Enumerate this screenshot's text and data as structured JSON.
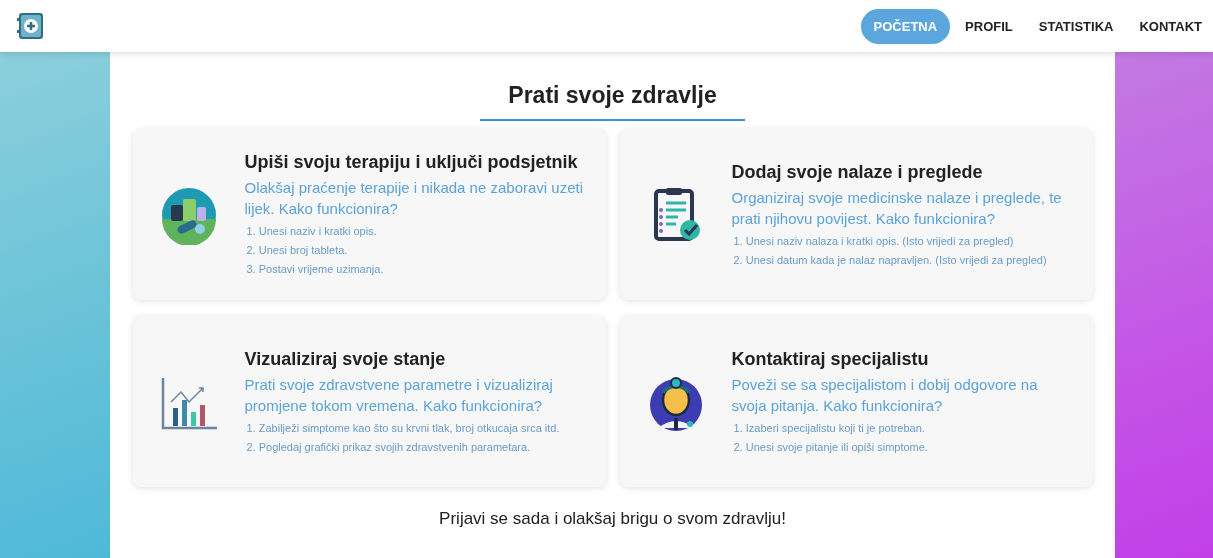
{
  "nav": {
    "items": [
      {
        "label": "POČETNA",
        "selected": true
      },
      {
        "label": "PROFIL",
        "selected": false
      },
      {
        "label": "STATISTIKA",
        "selected": false
      },
      {
        "label": "KONTAKT",
        "selected": false
      }
    ]
  },
  "main": {
    "title": "Prati svoje zdravlje",
    "cards": [
      {
        "kind": "pills",
        "title": "Upiši svoju terapiju i uključi podsjetnik",
        "description": "Olakšaj praćenje terapije i nikada ne zaboravi uzeti lijek. Kako funkcionira?",
        "steps": [
          "1. Unesi naziv i kratki opis.",
          "2. Unesi broj tableta.",
          "3. Postavi vrijeme uzimanja."
        ]
      },
      {
        "kind": "clipboard",
        "title": "Dodaj svoje nalaze i preglede",
        "description": "Organiziraj svoje medicinske nalaze i preglede, te prati njihovu povijest. Kako funkcionira?",
        "steps": [
          "1. Unesi naziv nalaza i kratki opis. (Isto vrijedi za pregled)",
          "2. Unesi datum kada je nalaz napravljen. (Isto vrijedi za pregled)"
        ]
      },
      {
        "kind": "chart",
        "title": "Vizualiziraj svoje stanje",
        "description": "Prati svoje zdravstvene parametre i vizualiziraj promjene tokom vremena. Kako funkcionira?",
        "steps": [
          "1. Zabilježi simptome kao što su krvni tlak, broj otkucaja srca itd.",
          "2. Pogledaj grafički prikaz svojih zdravstvenih parametara."
        ]
      },
      {
        "kind": "doctor",
        "title": "Kontaktiraj specijalistu",
        "description": "Poveži se sa specijalistom i dobij odgovore na svoja pitanja. Kako funkcionira?",
        "steps": [
          "1. Izaberi specijalistu koji ti je potreban.",
          "2. Unesi svoje pitanje ili opiši simptome."
        ]
      }
    ],
    "footer": "Prijavi se sada i olakšaj brigu o svom zdravlju!"
  }
}
